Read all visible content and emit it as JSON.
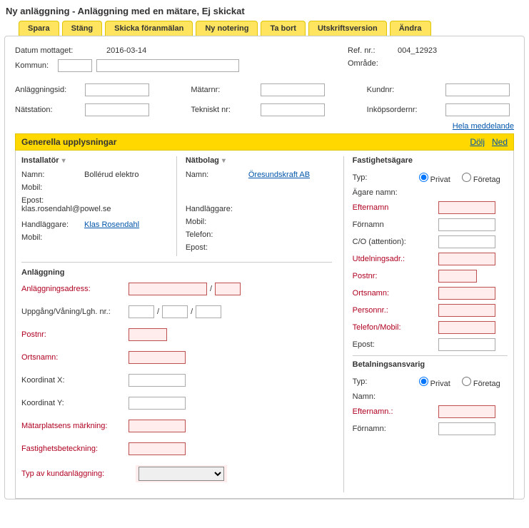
{
  "page_title": "Ny anläggning - Anläggning med en mätare, Ej skickat",
  "toolbar": {
    "save": "Spara",
    "close": "Stäng",
    "send": "Skicka föranmälan",
    "new_note": "Ny notering",
    "delete": "Ta bort",
    "print": "Utskriftsversion",
    "edit": "Ändra"
  },
  "header": {
    "datum_mottaget_label": "Datum mottaget:",
    "datum_mottaget": "2016-03-14",
    "kommun_label": "Kommun:",
    "kommun_code": "",
    "kommun_name": "",
    "refnr_label": "Ref. nr.:",
    "refnr": "004_12923",
    "omrade_label": "Område:"
  },
  "ids": {
    "anlaggningsid_label": "Anläggningsid:",
    "natstation_label": "Nätstation:",
    "matarnr_label": "Mätarnr:",
    "tekniskt_nr_label": "Tekniskt nr:",
    "kundnr_label": "Kundnr:",
    "inkopsordernr_label": "Inköpsordernr:"
  },
  "full_message_link": "Hela meddelande",
  "section_title": "Generella upplysningar",
  "section_actions": {
    "hide": "Dölj",
    "down": "Ned"
  },
  "installer": {
    "head": "Installatör",
    "namn_label": "Namn:",
    "namn": "Bollérud elektro",
    "mobil_label": "Mobil:",
    "epost_label": "Epost:",
    "epost": "klas.rosendahl@powel.se",
    "handlaggare_label": "Handläggare:",
    "handlaggare": "Klas Rosendahl",
    "mobil2_label": "Mobil:"
  },
  "natbolag": {
    "head": "Nätbolag",
    "namn_label": "Namn:",
    "namn": "Öresundskraft AB",
    "handlaggare_label": "Handläggare:",
    "mobil_label": "Mobil:",
    "telefon_label": "Telefon:",
    "epost_label": "Epost:"
  },
  "anlaggning": {
    "head": "Anläggning",
    "adress_label": "Anläggningsadress:",
    "uppgang_label": "Uppgång/Våning/Lgh. nr.:",
    "postnr_label": "Postnr:",
    "ortsnamn_label": "Ortsnamn:",
    "koordx_label": "Koordinat X:",
    "koordy_label": "Koordinat Y:",
    "matarplats_label": "Mätarplatsens märkning:",
    "fastighet_label": "Fastighetsbeteckning:",
    "typ_label": "Typ av kundanläggning:"
  },
  "owner": {
    "head": "Fastighetsägare",
    "typ_label": "Typ:",
    "privat": "Privat",
    "foretag": "Företag",
    "agare_label": "Ägare namn:",
    "efternamn_label": "Efternamn",
    "fornamn_label": "Förnamn",
    "co_label": "C/O (attention):",
    "utdel_label": "Utdelningsadr.:",
    "postnr_label": "Postnr:",
    "ortsnamn_label": "Ortsnamn:",
    "personnr_label": "Personnr.:",
    "telefon_label": "Telefon/Mobil:",
    "epost_label": "Epost:"
  },
  "payer": {
    "head": "Betalningsansvarig",
    "typ_label": "Typ:",
    "privat": "Privat",
    "foretag": "Företag",
    "namn_label": "Namn:",
    "efternamn_label": "Efternamn.:",
    "fornamn_label": "Förnamn:"
  }
}
